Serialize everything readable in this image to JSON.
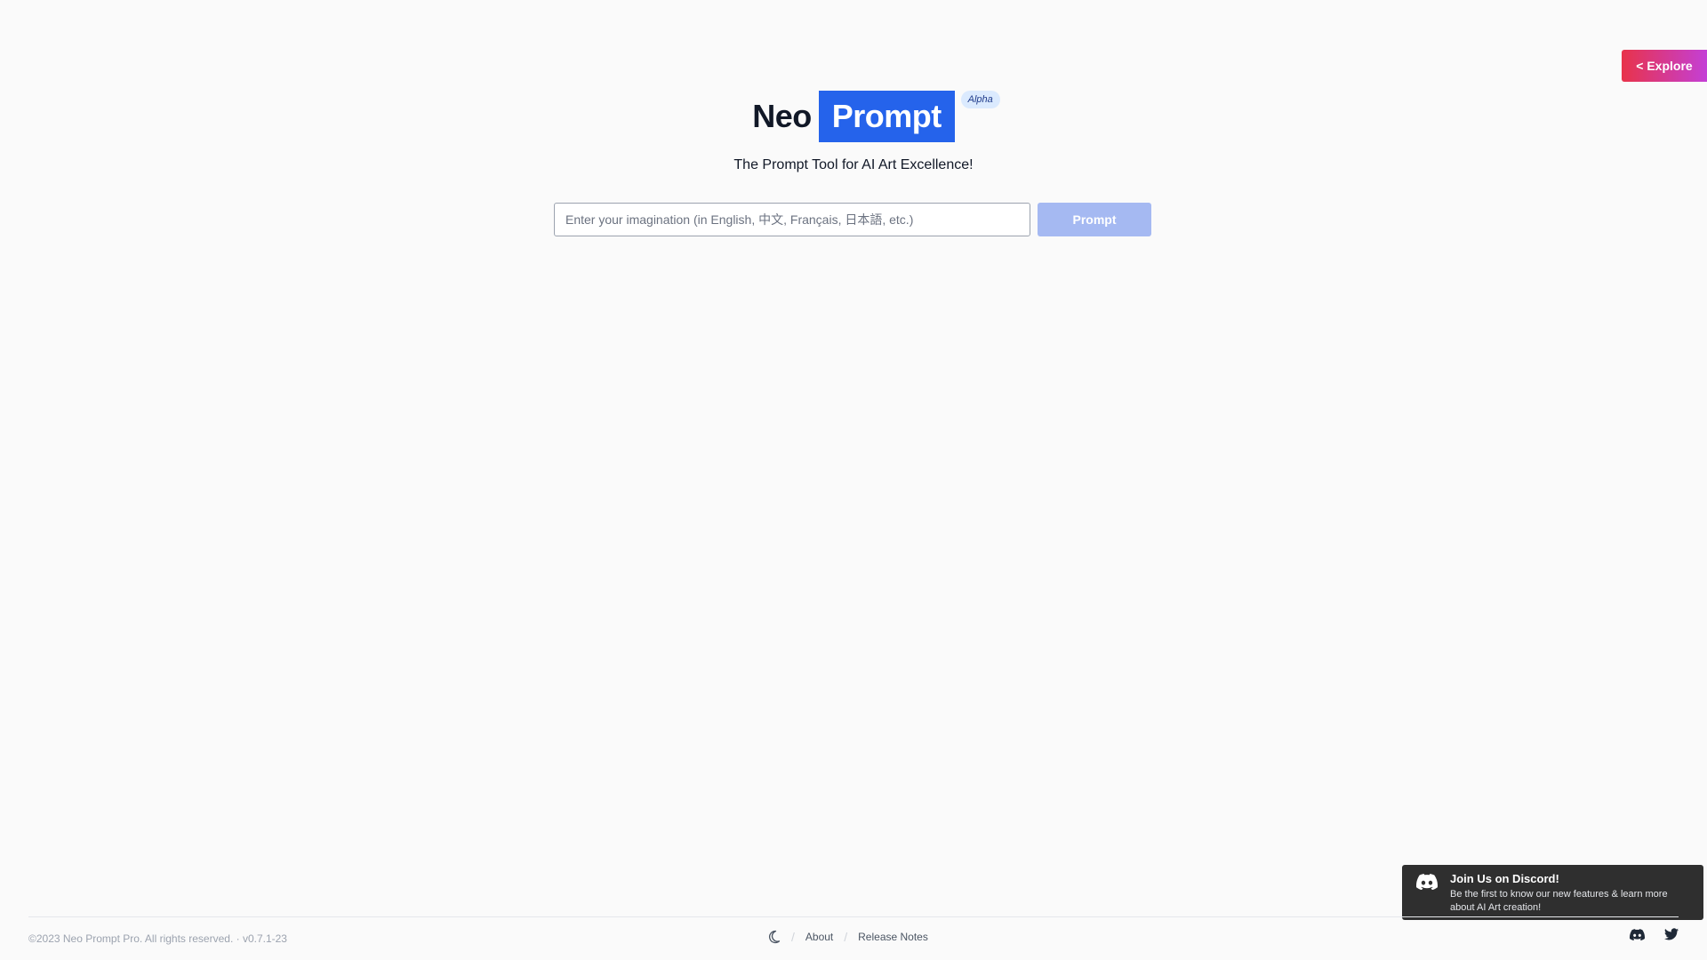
{
  "header": {
    "explore_label": "< Explore"
  },
  "hero": {
    "logo_neo": "Neo",
    "logo_prompt": "Prompt",
    "badge": "Alpha",
    "tagline": "The Prompt Tool for AI Art Excellence!"
  },
  "search": {
    "placeholder": "Enter your imagination (in English, 中文, Français, 日本語, etc.)",
    "value": "",
    "button_label": "Prompt"
  },
  "toast": {
    "icon": "discord-icon",
    "title": "Join Us on Discord!",
    "body": "Be the first to know our new features & learn more about AI Art creation!"
  },
  "footer": {
    "copyright": "©2023 Neo Prompt Pro. All rights reserved. · v0.7.1-23",
    "theme_icon": "moon-icon",
    "links": [
      {
        "label": "About"
      },
      {
        "label": "Release Notes"
      }
    ],
    "social": [
      "discord-icon",
      "twitter-icon"
    ]
  },
  "colors": {
    "background": "#fafafa",
    "brand_blue": "#2563eb",
    "explore_gradient_start": "#e8334a",
    "explore_gradient_end": "#c43fd6",
    "prompt_button_disabled": "#a5b9f2",
    "toast_bg": "#2f2f2f"
  }
}
